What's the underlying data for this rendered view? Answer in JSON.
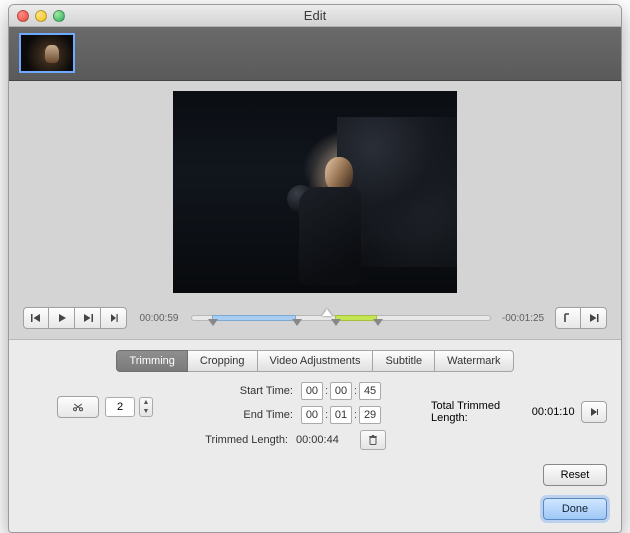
{
  "window": {
    "title": "Edit"
  },
  "playback": {
    "current_time": "00:00:59",
    "remaining_time": "-00:01:25",
    "blue_segment": {
      "start_pct": 7,
      "end_pct": 35
    },
    "green_segment": {
      "start_pct": 48,
      "end_pct": 62
    },
    "playhead_pct": 45
  },
  "tabs": {
    "items": [
      "Trimming",
      "Cropping",
      "Video Adjustments",
      "Subtitle",
      "Watermark"
    ],
    "active_index": 0
  },
  "trimming": {
    "segment_count": "2",
    "start_label": "Start Time:",
    "end_label": "End Time:",
    "trimmed_label": "Trimmed Length:",
    "total_label": "Total Trimmed Length:",
    "start": {
      "hh": "00",
      "mm": "00",
      "ss": "45"
    },
    "end": {
      "hh": "00",
      "mm": "01",
      "ss": "29"
    },
    "trimmed_length": "00:00:44",
    "total_trimmed_length": "00:01:10"
  },
  "buttons": {
    "reset": "Reset",
    "done": "Done"
  },
  "icons": {
    "prev": "|◀",
    "play": "▶",
    "next": "▶|",
    "step": "▶|",
    "in_bracket": "⌐",
    "out_bracket": "▶|",
    "scissors": "✂",
    "trash": "🗑",
    "export": "▶"
  }
}
